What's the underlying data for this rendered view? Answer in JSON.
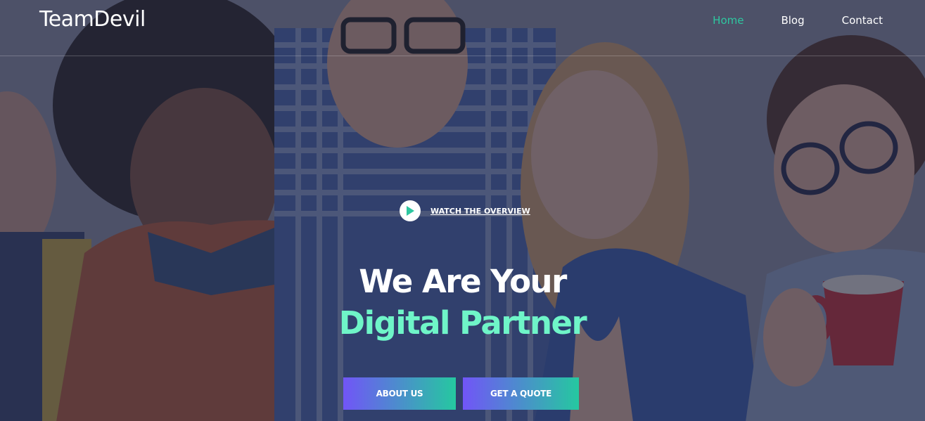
{
  "header": {
    "logo": "TeamDevil",
    "nav": [
      {
        "label": "Home",
        "active": true
      },
      {
        "label": "Blog",
        "active": false
      },
      {
        "label": "Contact",
        "active": false
      }
    ]
  },
  "hero": {
    "watch_label": "WATCH THE OVERVIEW",
    "headline_line1": "We Are Your",
    "headline_line2": "Digital Partner",
    "buttons": {
      "about": "ABOUT US",
      "quote": "GET A QUOTE"
    }
  },
  "colors": {
    "accent": "#2ec7a0",
    "headline_highlight": "#6ff5c8",
    "gradient_start": "#7155f7",
    "gradient_end": "#25c8a0"
  },
  "icons": {
    "play": "play-icon"
  }
}
